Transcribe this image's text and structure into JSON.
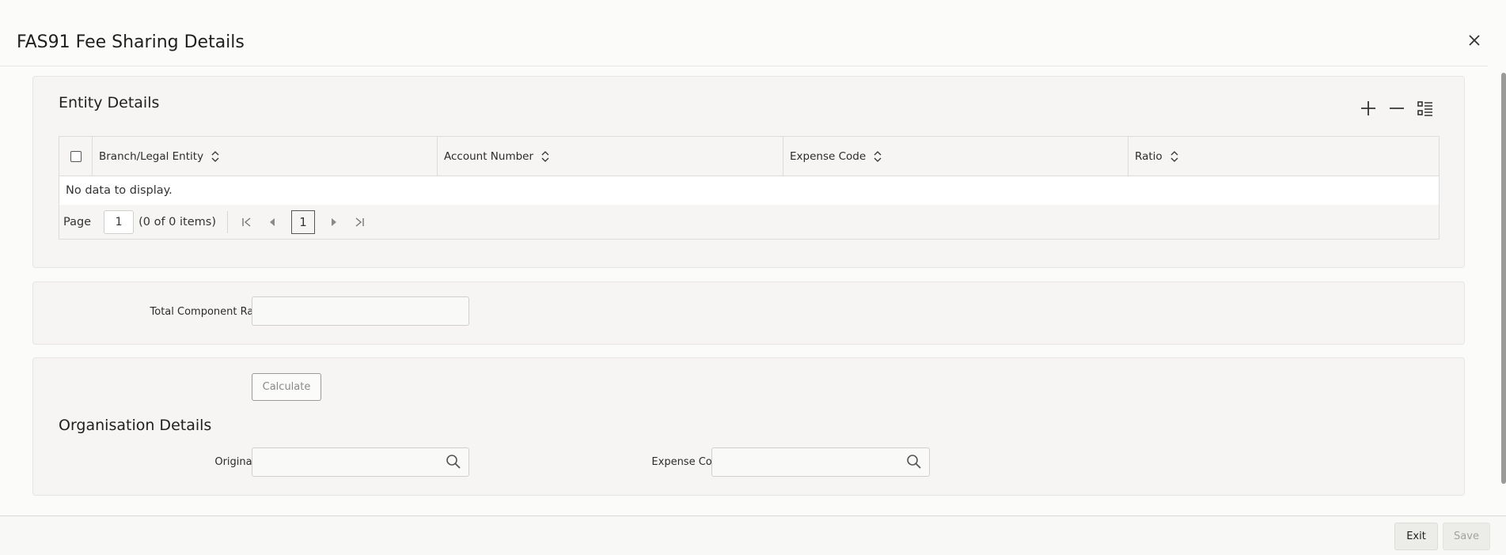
{
  "dialog": {
    "title": "FAS91 Fee Sharing Details",
    "close_icon": "close-icon"
  },
  "entity_details": {
    "title": "Entity Details",
    "toolbar": {
      "add_icon": "plus-icon",
      "remove_icon": "minus-icon",
      "view_icon": "list-view-icon"
    },
    "columns": [
      {
        "label": "Branch/Legal Entity"
      },
      {
        "label": "Account Number"
      },
      {
        "label": "Expense Code"
      },
      {
        "label": "Ratio"
      }
    ],
    "empty_message": "No data to display.",
    "pager": {
      "label": "Page",
      "current_page_value": "1",
      "count_text": "(0 of 0 items)",
      "page_number": "1"
    }
  },
  "total": {
    "label": "Total Component Ratio",
    "value": ""
  },
  "organisation": {
    "calculate_label": "Calculate",
    "title": "Organisation Details",
    "originator_label": "Originator",
    "originator_value": "",
    "expense_code_label": "Expense Code",
    "expense_code_value": ""
  },
  "footer": {
    "exit_label": "Exit",
    "save_label": "Save"
  }
}
